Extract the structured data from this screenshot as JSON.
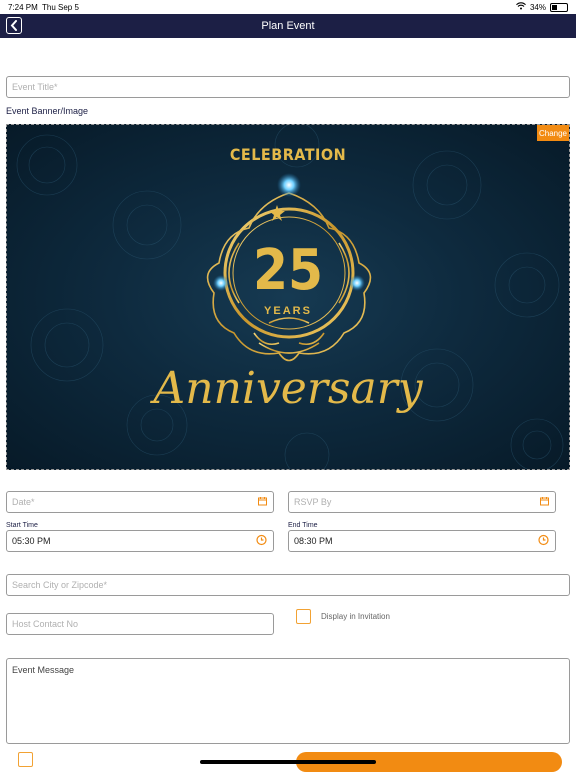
{
  "status_bar": {
    "time": "7:24 PM",
    "date": "Thu Sep 5",
    "battery": "34%",
    "battery_level": 0.34,
    "icons": [
      "wifi-icon",
      "battery-icon"
    ]
  },
  "nav": {
    "title": "Plan Event",
    "back_icon": "chevron-left-icon",
    "background": "#1c1f45"
  },
  "form": {
    "event_title_placeholder": "Event Title*",
    "banner_label": "Event Banner/Image",
    "change_label": "Change",
    "banner_text": {
      "top": "CELEBRATION",
      "number": "25",
      "years": "YEARS",
      "script": "Anniversary"
    },
    "date_placeholder": "Date*",
    "rsvp_placeholder": "RSVP By",
    "start_time_label": "Start Time",
    "start_time_value": "05:30 PM",
    "end_time_label": "End Time",
    "end_time_value": "08:30 PM",
    "search_placeholder": "Search City or Zipcode*",
    "host_contact_placeholder": "Host Contact No",
    "display_invitation_label": "Display in Invitation",
    "display_invitation_checked": false,
    "event_message_label": "Event Message"
  },
  "colors": {
    "accent": "#f28b12",
    "navy": "#1c1f45",
    "gold": "#e3b94a"
  }
}
